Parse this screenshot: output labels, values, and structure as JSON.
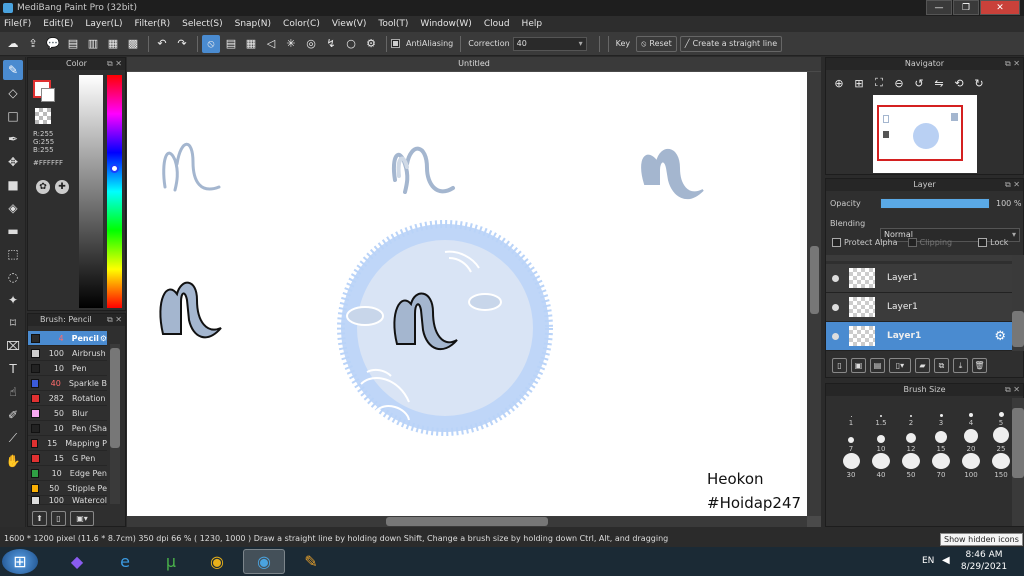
{
  "window": {
    "title": "MediBang Paint Pro (32bit)",
    "minimize": "—",
    "maximize": "❐",
    "close": "✕"
  },
  "menu": [
    "File(F)",
    "Edit(E)",
    "Layer(L)",
    "Filter(R)",
    "Select(S)",
    "Snap(N)",
    "Color(C)",
    "View(V)",
    "Tool(T)",
    "Window(W)",
    "Cloud",
    "Help"
  ],
  "toolbar": {
    "antialiasing": "AntiAliasing",
    "correction_label": "Correction",
    "correction_value": "40",
    "key_label": "Key",
    "reset_label": "Reset",
    "straight_line_label": "Create a straight line"
  },
  "color_panel": {
    "title": "Color",
    "r": "R:255",
    "g": "G:255",
    "b": "B:255",
    "hex": "#FFFFFF"
  },
  "brush_panel": {
    "title": "Brush: Pencil",
    "items": [
      {
        "size": "4",
        "name": "Pencil",
        "color": "#2a2a2a"
      },
      {
        "size": "100",
        "name": "Airbrush",
        "color": "#cfcfcf"
      },
      {
        "size": "10",
        "name": "Pen",
        "color": "#222222"
      },
      {
        "size": "40",
        "name": "Sparkle B",
        "color": "#3b5bdb"
      },
      {
        "size": "282",
        "name": "Rotation",
        "color": "#e03131"
      },
      {
        "size": "50",
        "name": "Blur",
        "color": "#f7a8f0"
      },
      {
        "size": "10",
        "name": "Pen (Sha",
        "color": "#222222"
      },
      {
        "size": "15",
        "name": "Mapping P",
        "color": "#e03131"
      },
      {
        "size": "15",
        "name": "G Pen",
        "color": "#e03131"
      },
      {
        "size": "10",
        "name": "Edge Pen",
        "color": "#2f9e44"
      },
      {
        "size": "50",
        "name": "Stipple Pe",
        "color": "#fab005"
      },
      {
        "size": "100",
        "name": "Watercol",
        "color": "#dddddd"
      }
    ]
  },
  "document": {
    "tab": "Untitled",
    "watermark_line1": "Heokon",
    "watermark_line2": "#Hoidap247"
  },
  "navigator": {
    "title": "Navigator"
  },
  "layer_panel": {
    "title": "Layer",
    "opacity_label": "Opacity",
    "opacity_value": "100 %",
    "blending_label": "Blending",
    "blending_value": "Normal",
    "protect_alpha": "Protect Alpha",
    "clipping": "Clipping",
    "lock": "Lock",
    "layers": [
      {
        "name": "Layer1"
      },
      {
        "name": "Layer1"
      },
      {
        "name": "Layer1"
      }
    ]
  },
  "brush_size": {
    "title": "Brush Size",
    "sizes": [
      "1",
      "1.5",
      "2",
      "3",
      "4",
      "5",
      "7",
      "10",
      "12",
      "15",
      "20",
      "25",
      "30",
      "40",
      "50",
      "70",
      "100",
      "150"
    ]
  },
  "status": {
    "text": "1600 * 1200 pixel   (11.6 * 8.7cm)   350 dpi   66 %   ( 1230, 1000 )   Draw a straight line by holding down Shift, Change a brush size by holding down Ctrl, Alt, and dragging"
  },
  "taskbar": {
    "lang": "EN",
    "time": "8:46 AM",
    "date": "8/29/2021",
    "tooltip": "Show hidden icons"
  }
}
